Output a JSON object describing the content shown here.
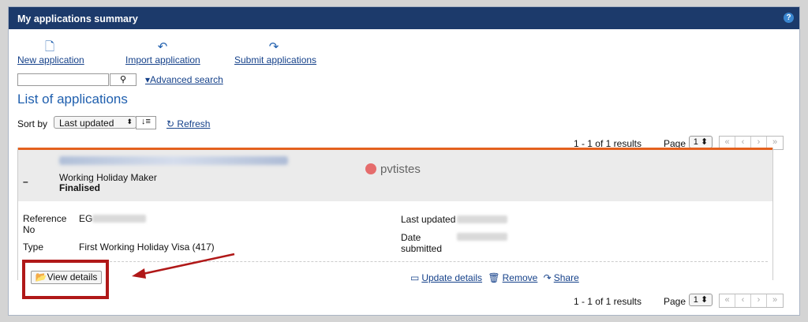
{
  "header": {
    "title": "My applications summary",
    "help_label": "?"
  },
  "actions": [
    {
      "label": "New application",
      "icon": "new-document-icon"
    },
    {
      "label": "Import application",
      "icon": "import-icon"
    },
    {
      "label": "Submit applications",
      "icon": "submit-icon"
    }
  ],
  "search": {
    "value": "",
    "placeholder": "",
    "advanced_label": "Advanced search"
  },
  "list": {
    "title": "List of applications"
  },
  "sort": {
    "label": "Sort by",
    "selected": "Last updated",
    "refresh_label": "Refresh"
  },
  "pagination": {
    "results": "1 - 1 of 1 results",
    "page_label": "Page",
    "page_value": "1"
  },
  "application": {
    "type_name": "Working Holiday Maker",
    "status": "Finalised",
    "reference_label": "Reference No",
    "reference_value": "EG",
    "type_label": "Type",
    "type_value": "First Working Holiday Visa (417)",
    "last_updated_label": "Last updated",
    "date_submitted_label": "Date submitted"
  },
  "buttons": {
    "view_details": "View details",
    "update_details": "Update details",
    "remove": "Remove",
    "share": "Share"
  },
  "watermark": "pvtistes",
  "colors": {
    "header_bg": "#1c3a6b",
    "accent": "#e4611e",
    "link": "#15418a",
    "annotation": "#b01818"
  }
}
